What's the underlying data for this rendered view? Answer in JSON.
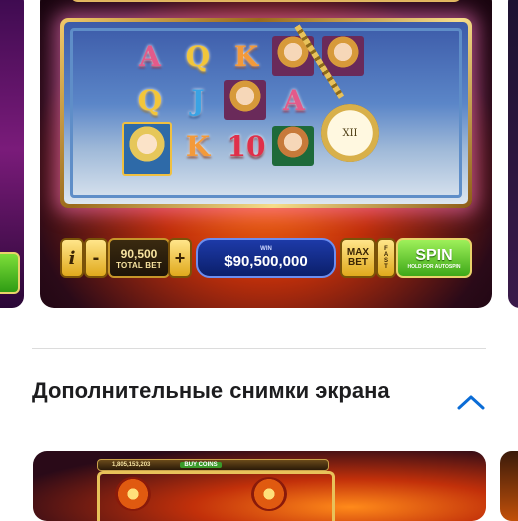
{
  "screenshot_main": {
    "reel_symbols": [
      "A",
      "Q",
      "K",
      "Q",
      "J",
      "A",
      "K",
      "10"
    ],
    "controls": {
      "info_label": "i",
      "minus_label": "-",
      "bet_value": "90,500",
      "bet_label": "TOTAL BET",
      "plus_label": "+",
      "win_label": "WIN",
      "win_value": "$90,500,000",
      "max_bet_line1": "MAX",
      "max_bet_line2": "BET",
      "fast_label": "FAST",
      "spin_label": "SPIN",
      "spin_sub_label": "HOLD FOR AUTOSPIN"
    }
  },
  "section": {
    "title": "Дополнительные снимки экрана"
  },
  "screenshot_next": {
    "coins_value": "1,805,153,203",
    "buy_coins_label": "BUY COINS"
  },
  "colors": {
    "accent": "#0a6cd6",
    "title_text": "#1d1d1f",
    "divider": "#dcdcdc"
  },
  "icons": {
    "expand_toggle": "chevron-up-icon"
  }
}
